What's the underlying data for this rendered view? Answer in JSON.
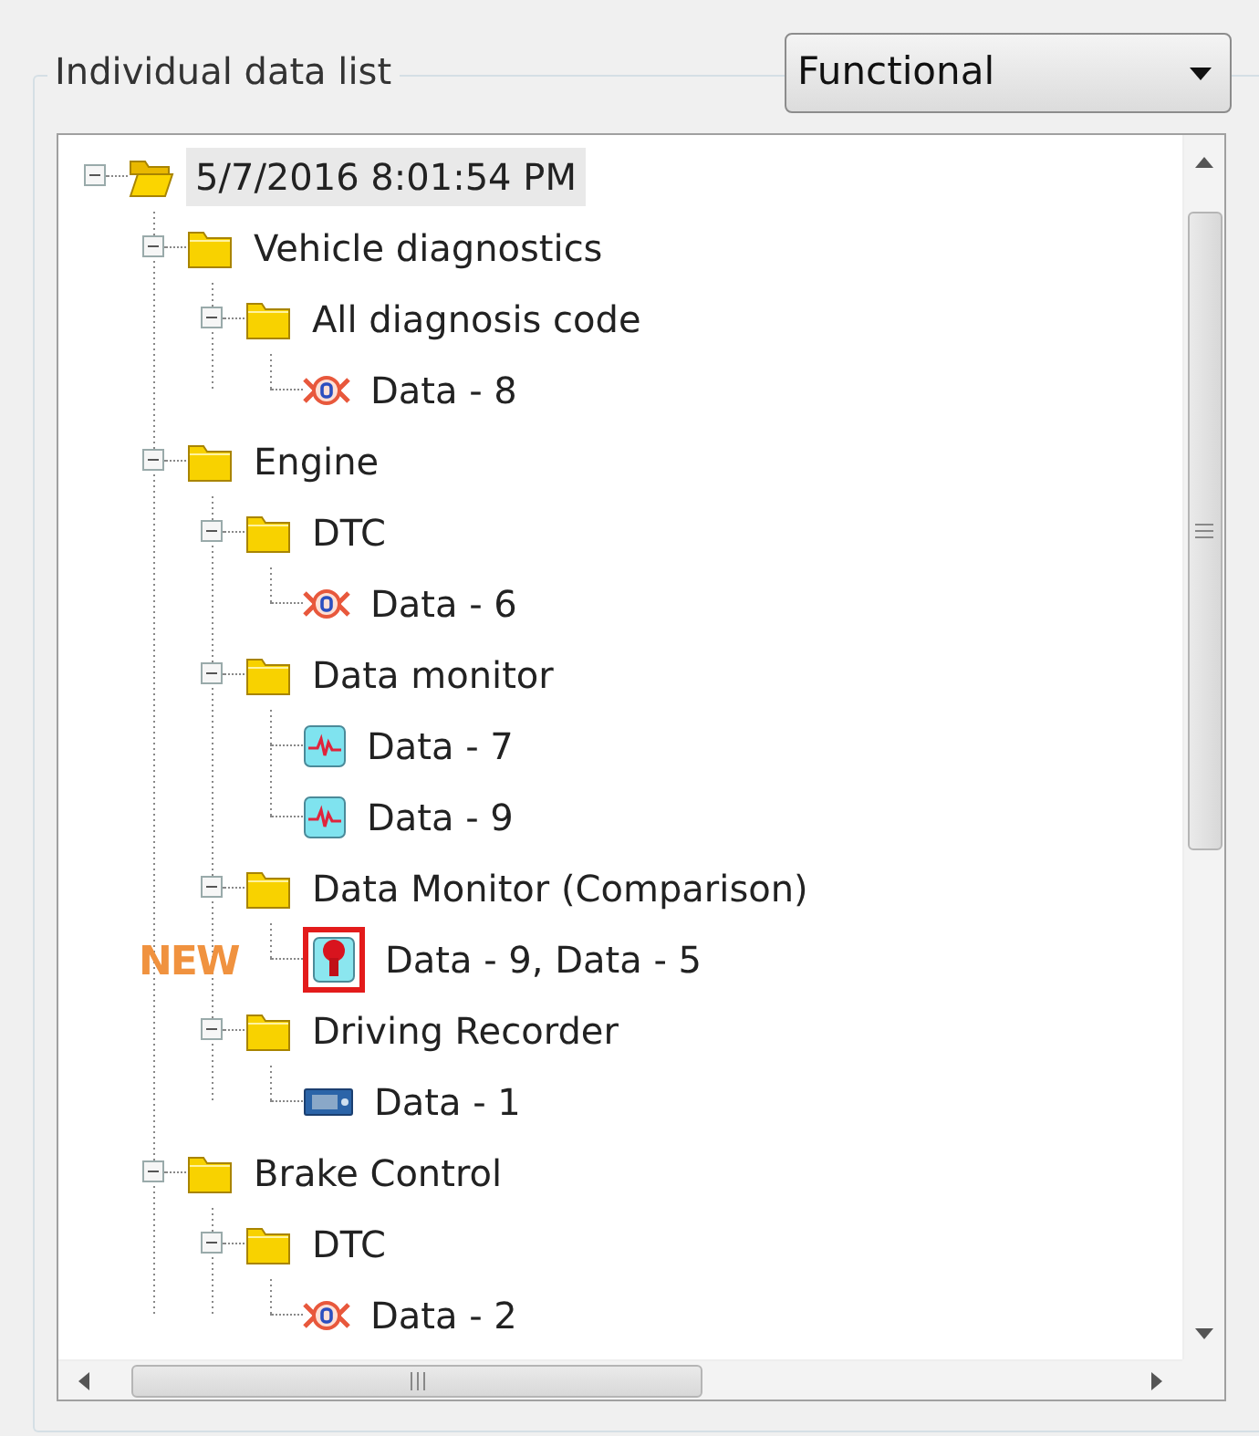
{
  "group_title": "Individual data list",
  "view_select": {
    "value": "Functional"
  },
  "tree": [
    {
      "kind": "folder",
      "label": "5/7/2016 8:01:54 PM",
      "expanded": true,
      "selected": true,
      "highlighted": false,
      "children": [
        {
          "kind": "folder",
          "label": "Vehicle diagnostics",
          "expanded": true,
          "selected": false,
          "highlighted": false,
          "children": [
            {
              "kind": "folder",
              "label": "All diagnosis code",
              "expanded": true,
              "selected": false,
              "highlighted": false,
              "children": [
                {
                  "kind": "dtc",
                  "label": "Data - 8",
                  "selected": false,
                  "highlighted": false
                }
              ]
            }
          ]
        },
        {
          "kind": "folder",
          "label": "Engine",
          "expanded": true,
          "selected": false,
          "highlighted": false,
          "children": [
            {
              "kind": "folder",
              "label": "DTC",
              "expanded": true,
              "selected": false,
              "highlighted": false,
              "children": [
                {
                  "kind": "dtc",
                  "label": "Data - 6",
                  "selected": false,
                  "highlighted": false
                }
              ]
            },
            {
              "kind": "folder",
              "label": "Data monitor",
              "expanded": true,
              "selected": false,
              "highlighted": false,
              "children": [
                {
                  "kind": "monitor",
                  "label": "Data - 7",
                  "selected": false,
                  "highlighted": false
                },
                {
                  "kind": "monitor",
                  "label": "Data - 9",
                  "selected": false,
                  "highlighted": false
                }
              ]
            },
            {
              "kind": "folder",
              "label": "Data Monitor (Comparison)",
              "expanded": true,
              "selected": false,
              "highlighted": false,
              "children": [
                {
                  "kind": "comparison",
                  "label": "Data - 9, Data - 5",
                  "selected": false,
                  "highlighted": true,
                  "badge": "NEW"
                }
              ]
            },
            {
              "kind": "folder",
              "label": "Driving Recorder",
              "expanded": true,
              "selected": false,
              "highlighted": false,
              "children": [
                {
                  "kind": "recorder",
                  "label": "Data - 1",
                  "selected": false,
                  "highlighted": false
                }
              ]
            }
          ]
        },
        {
          "kind": "folder",
          "label": "Brake Control",
          "expanded": true,
          "selected": false,
          "highlighted": false,
          "children": [
            {
              "kind": "folder",
              "label": "DTC",
              "expanded": true,
              "selected": false,
              "highlighted": false,
              "children": [
                {
                  "kind": "dtc",
                  "label": "Data - 2",
                  "selected": false,
                  "highlighted": false
                }
              ]
            }
          ]
        }
      ]
    }
  ]
}
